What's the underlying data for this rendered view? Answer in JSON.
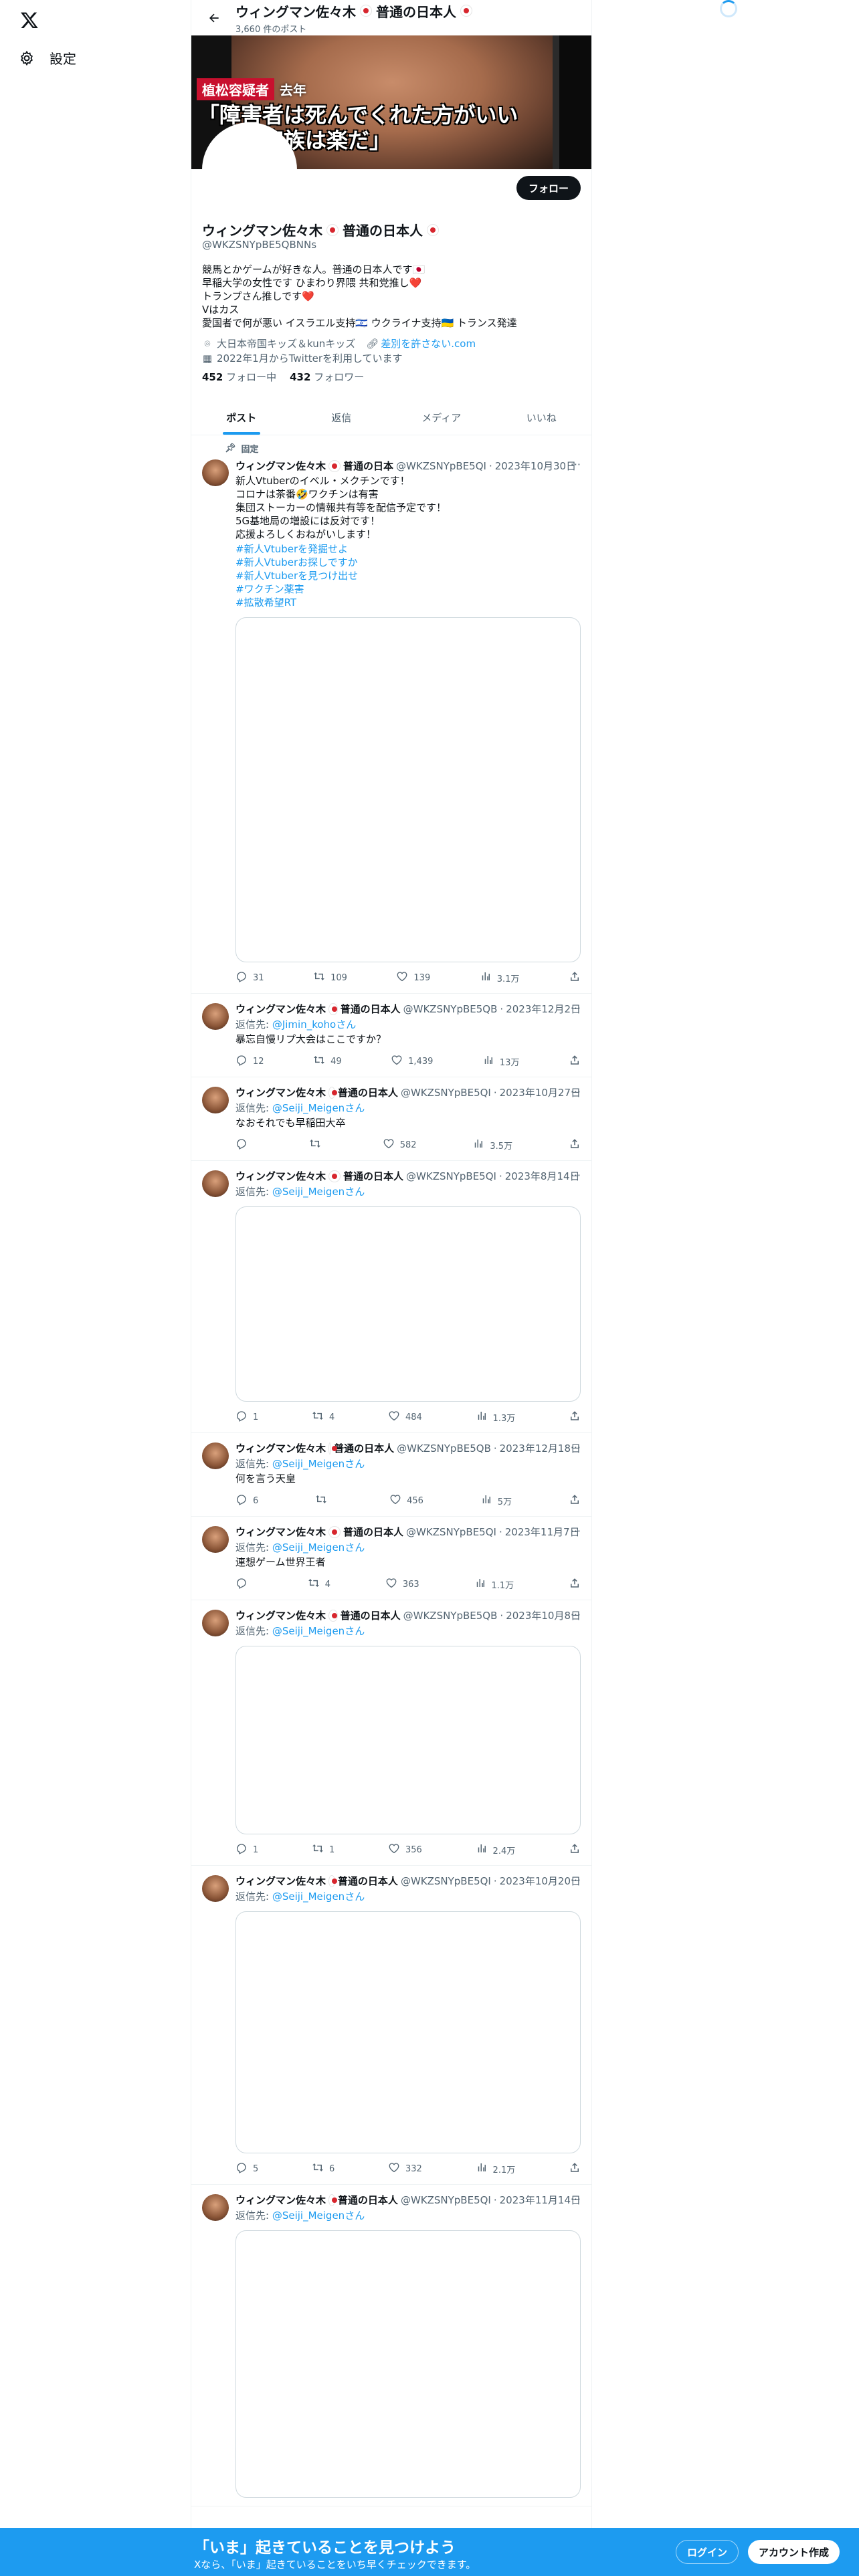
{
  "nav": {
    "settings_label": "設定"
  },
  "header": {
    "name": "ウィングマン佐々木",
    "name_suffix": "普通の日本人",
    "post_count": "3,660 件のポスト"
  },
  "banner": {
    "tag_name": "植松容疑者",
    "tag_year": "去年",
    "quote_line1": "「障害者は死んでくれた方がいい",
    "quote_line2": "　　が家族は楽だ」"
  },
  "profile": {
    "follow_label": "フォロー",
    "name": "ウィングマン佐々木",
    "name_suffix": "普通の日本人",
    "handle": "@WKZSNYpBE5QBNNs",
    "bio": "競馬とかゲームが好きな人。普通の日本人です🇯🇵\n早稲大学の女性です ひまわり界隈 共和党推し❤️\nトランプさん推しです❤️\nVはカス\n愛国者で何が悪い イスラエル支持🇮🇱 ウクライナ支持🇺🇦 トランス発達",
    "location": "大日本帝国キッズ＆kunキッズ",
    "link": "差別を許さない.com",
    "joined": "2022年1月からTwitterを利用しています",
    "following_count": "452",
    "following_label": "フォロー中",
    "followers_count": "432",
    "followers_label": "フォロワー"
  },
  "tabs": [
    "ポスト",
    "返信",
    "メディア",
    "いいね"
  ],
  "pinned_label": "固定",
  "posts": [
    {
      "name": "ウィングマン佐々木",
      "suffix": "普通の日本",
      "handle": "@WKZSNYpBE5QI",
      "date": "2023年10月30日",
      "reply_to": "",
      "text": "新人Vtuberのイベル・メクチンです！\nコロナは茶番🤣ワクチンは有害\n集団ストーカーの情報共有等を配信予定です！\n5G基地局の増設には反対です！\n応援よろしくおねがいします！",
      "hashtags": [
        "#新人Vtuberを発掘せよ",
        "#新人Vtuberお探しですか",
        "#新人Vtuberを見つけ出せ",
        "#ワクチン薬害",
        "#拡散希望RT"
      ],
      "replies": "31",
      "reposts": "109",
      "likes": "139",
      "views": "3.1万"
    },
    {
      "name": "ウィングマン佐々木",
      "suffix": "普通の日本人",
      "handle": "@WKZSNYpBE5QB",
      "date": "2023年12月2日",
      "reply_to": "@Jimin_kohoさん",
      "text": "暴忘自慢リプ大会はここですか？",
      "replies": "12",
      "reposts": "49",
      "likes": "1,439",
      "views": "13万"
    },
    {
      "name": "ウィングマン佐々木",
      "suffix": "普通の日本人",
      "handle": "@WKZSNYpBE5QI",
      "date": "2023年10月27日",
      "reply_to": "@Seiji_Meigenさん",
      "text": "なおそれでも早稲田大卒",
      "replies": "",
      "reposts": "",
      "likes": "582",
      "views": "3.5万"
    },
    {
      "name": "ウィングマン佐々木",
      "suffix": "普通の日本人",
      "handle": "@WKZSNYpBE5QI",
      "date": "2023年8月14日",
      "reply_to": "@Seiji_Meigenさん",
      "text": "",
      "replies": "1",
      "reposts": "4",
      "likes": "484",
      "views": "1.3万"
    },
    {
      "name": "ウィングマン佐々木",
      "suffix": "普通の日本人",
      "handle": "@WKZSNYpBE5QB",
      "date": "2023年12月18日",
      "reply_to": "@Seiji_Meigenさん",
      "text": "何を言う天皇",
      "replies": "6",
      "reposts": "",
      "likes": "456",
      "views": "5万"
    },
    {
      "name": "ウィングマン佐々木",
      "suffix": "普通の日本人",
      "handle": "@WKZSNYpBE5QI",
      "date": "2023年11月7日",
      "reply_to": "@Seiji_Meigenさん",
      "text": "連想ゲーム世界王者",
      "replies": "",
      "reposts": "4",
      "likes": "363",
      "views": "1.1万"
    },
    {
      "name": "ウィングマン佐々木",
      "suffix": "普通の日本人",
      "handle": "@WKZSNYpBE5QB",
      "date": "2023年10月8日",
      "reply_to": "@Seiji_Meigenさん",
      "text": "",
      "replies": "1",
      "reposts": "1",
      "likes": "356",
      "views": "2.4万"
    },
    {
      "name": "ウィングマン佐々木",
      "suffix": "普通の日本人",
      "handle": "@WKZSNYpBE5QI",
      "date": "2023年10月20日",
      "reply_to": "@Seiji_Meigenさん",
      "text": "",
      "replies": "5",
      "reposts": "6",
      "likes": "332",
      "views": "2.1万"
    },
    {
      "name": "ウィングマン佐々木",
      "suffix": "普通の日本人",
      "handle": "@WKZSNYpBE5QI",
      "date": "2023年11月14日",
      "reply_to": "@Seiji_Meigenさん",
      "text": "",
      "replies": "",
      "reposts": "",
      "likes": "",
      "views": ""
    }
  ],
  "reply_prefix": "返信先:",
  "bottom_bar": {
    "title": "「いま」起きていることを見つけよう",
    "subtitle": "Xなら、「いま」起きていることをいち早くチェックできます。",
    "login": "ログイン",
    "signup": "アカウント作成"
  },
  "colors": {
    "accent": "#1d9bf0",
    "text": "#0f1419",
    "muted": "#536471",
    "border": "#eff3f4"
  }
}
